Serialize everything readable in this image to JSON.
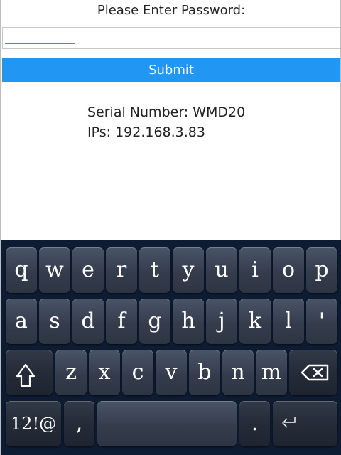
{
  "form": {
    "prompt": "Please Enter Password:",
    "password_value": "",
    "submit_label": "Submit"
  },
  "info": {
    "serial": "Serial Number: WMD20",
    "ips": "IPs: 192.168.3.83"
  },
  "keyboard": {
    "row1": [
      "q",
      "w",
      "e",
      "r",
      "t",
      "y",
      "u",
      "i",
      "o",
      "p"
    ],
    "row2": [
      "a",
      "s",
      "d",
      "f",
      "g",
      "h",
      "j",
      "k",
      "l",
      "'"
    ],
    "row3": [
      "z",
      "x",
      "c",
      "v",
      "b",
      "n",
      "m"
    ],
    "mode_label": "12!@",
    "comma": ",",
    "period": ".",
    "shift_icon": "shift-icon",
    "backspace_icon": "backspace-icon",
    "enter_icon": "enter-icon"
  }
}
